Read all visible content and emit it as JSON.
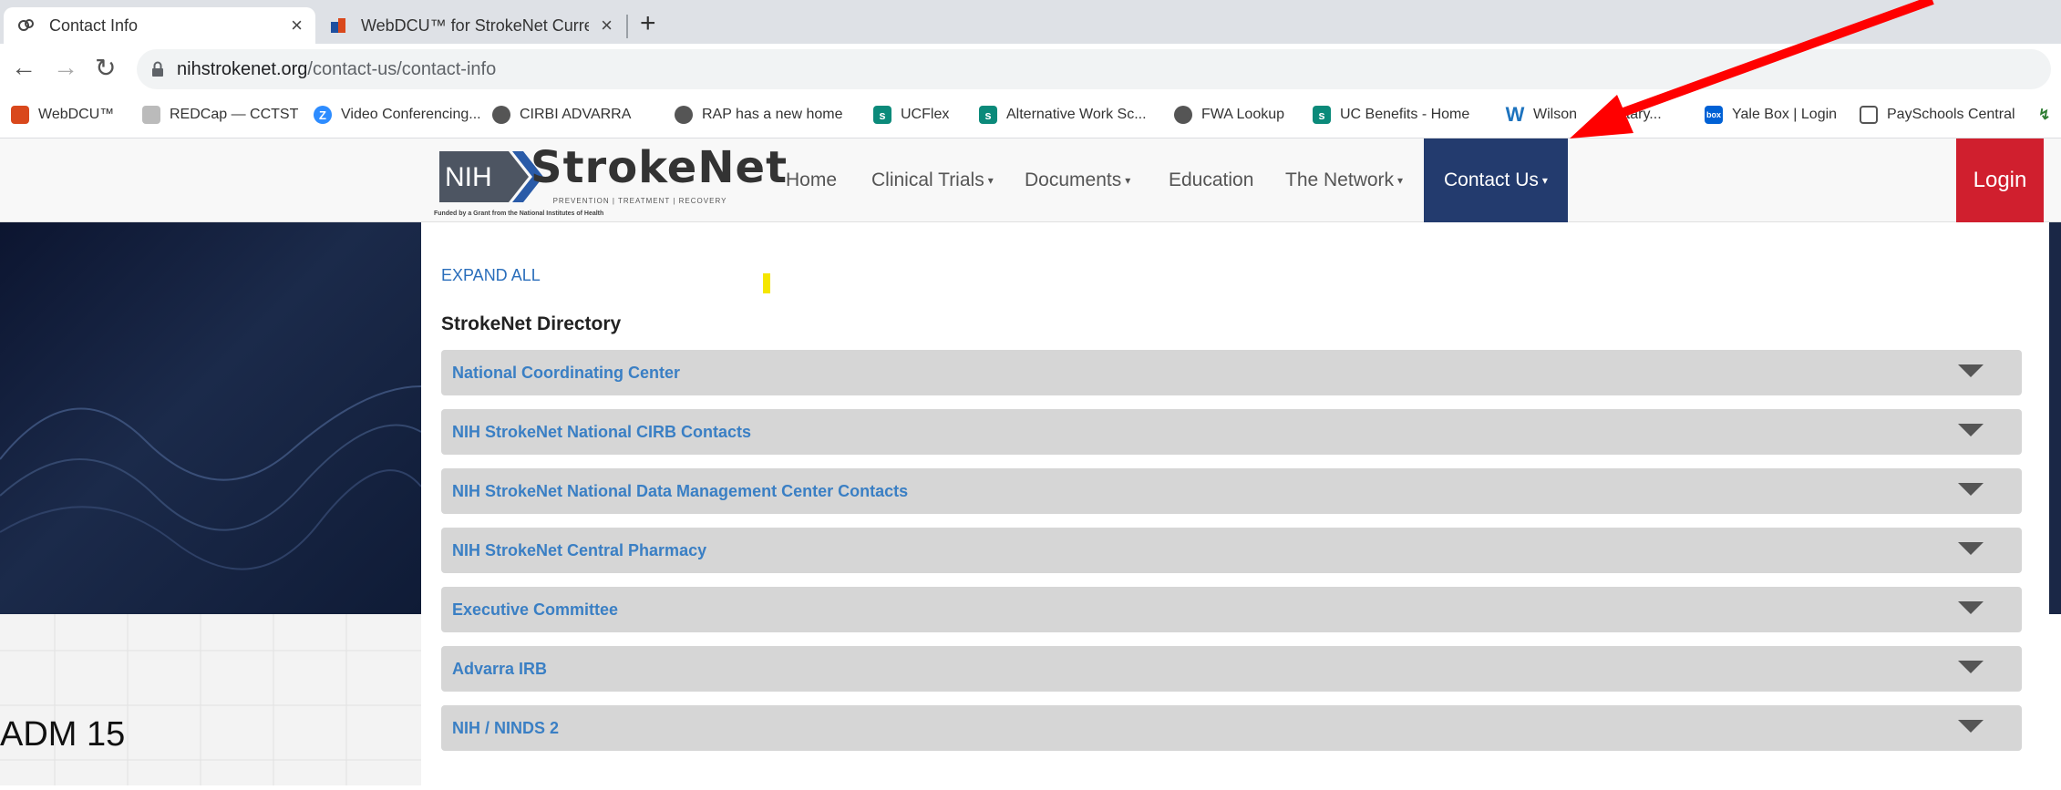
{
  "browser": {
    "tabs": [
      {
        "title": "Contact Info",
        "active": true
      },
      {
        "title": "WebDCU™ for StrokeNet  Curren",
        "active": false
      }
    ],
    "new_tab": "+",
    "tab_close": "×",
    "url_host": "nihstrokenet.org",
    "url_path": "/contact-us/contact-info"
  },
  "bookmarks": [
    {
      "label": "WebDCU™",
      "icon": "webdcu-icon",
      "color": "#d9481c"
    },
    {
      "label": "REDCap — CCTST",
      "icon": "redcap-icon",
      "color": "#999999"
    },
    {
      "label": "Video Conferencing...",
      "icon": "zoom-icon",
      "color": "#2d8cff"
    },
    {
      "label": "CIRBI ADVARRA",
      "icon": "globe-icon",
      "color": "#555555"
    },
    {
      "label": "RAP has a new home",
      "icon": "globe-icon",
      "color": "#555555"
    },
    {
      "label": "UCFlex",
      "icon": "sharepoint-icon",
      "color": "#0b8a7a"
    },
    {
      "label": "Alternative Work Sc...",
      "icon": "sharepoint-icon",
      "color": "#0b8a7a"
    },
    {
      "label": "FWA Lookup",
      "icon": "globe-icon",
      "color": "#555555"
    },
    {
      "label": "UC Benefits - Home",
      "icon": "sharepoint-icon",
      "color": "#0b8a7a"
    },
    {
      "label": "Wilson",
      "icon": "w-logo-icon",
      "color": "#1e73be"
    },
    {
      "label": "entary...",
      "icon": "",
      "color": ""
    },
    {
      "label": "Yale Box | Login",
      "icon": "box-icon",
      "color": "#0061d5"
    },
    {
      "label": "PaySchools Central",
      "icon": "page-icon",
      "color": "#555555"
    }
  ],
  "site": {
    "logo_nih": "NIH",
    "logo_name": "StrokeNet",
    "logo_tagline": "PREVENTION  |  TREATMENT  |  RECOVERY",
    "logo_funded": "Funded by a Grant from the National Institutes of Health",
    "nav": {
      "home": "Home",
      "clinical_trials": "Clinical Trials",
      "documents": "Documents",
      "education": "Education",
      "network": "The Network",
      "contact": "Contact Us",
      "caret": "▾"
    },
    "login": "Login"
  },
  "content": {
    "expand_all": "EXPAND ALL",
    "directory_title": "StrokeNet Directory",
    "sections": [
      "National Coordinating Center",
      "NIH StrokeNet National CIRB Contacts",
      "NIH StrokeNet National Data Management Center Contacts",
      "NIH StrokeNet Central Pharmacy",
      "Executive Committee",
      "Advarra IRB",
      "NIH / NINDS 2"
    ]
  },
  "annotation": {
    "label": "ADM 15",
    "arrow_color": "#ff0000",
    "highlight_color": "#f5e600"
  }
}
